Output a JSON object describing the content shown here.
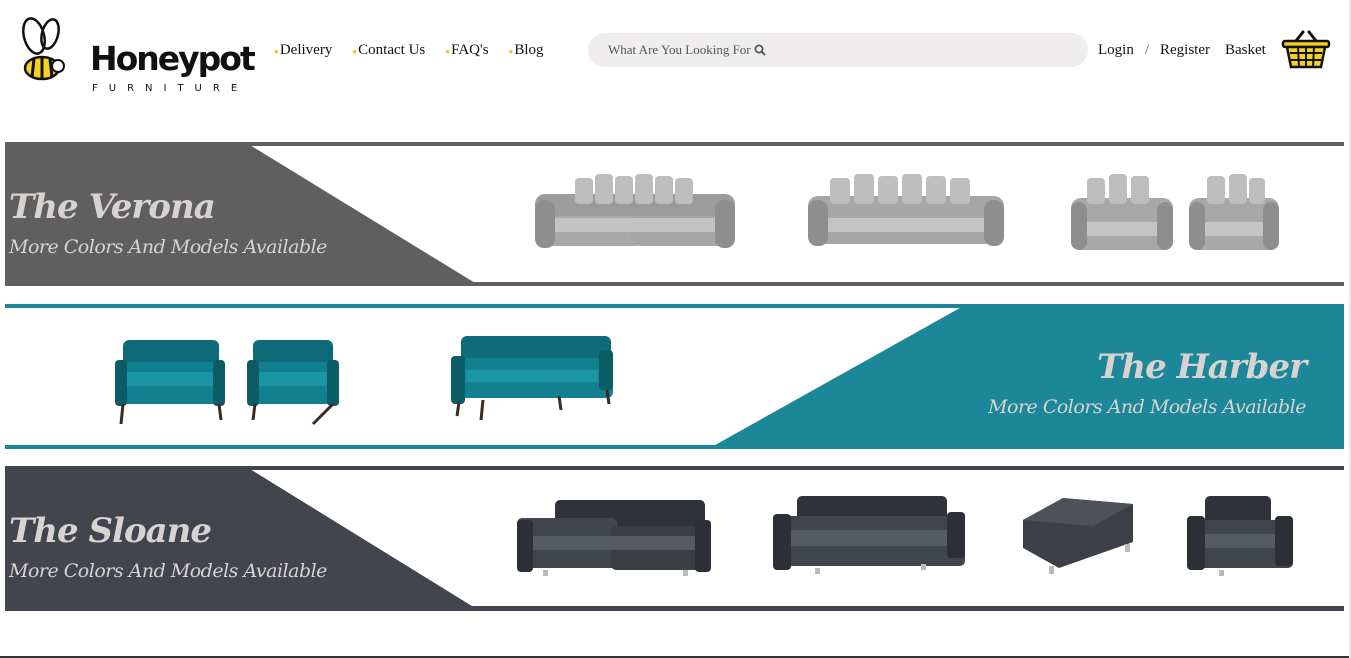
{
  "brand": {
    "name": "Honeypot",
    "tagline": "FURNITURE"
  },
  "nav": [
    {
      "label": "Delivery"
    },
    {
      "label": "Contact Us"
    },
    {
      "label": "FAQ's"
    },
    {
      "label": "Blog"
    }
  ],
  "search": {
    "placeholder": "What Are You Looking For"
  },
  "account": {
    "login": "Login",
    "separator": "/",
    "register": "Register",
    "basket": "Basket"
  },
  "banners": [
    {
      "title": "The Verona",
      "subtitle": "More Colors And Models Available",
      "color": "#5f5f5f",
      "products": [
        "corner sofa",
        "corner sofa",
        "sofa and armchair set"
      ]
    },
    {
      "title": "The Harber",
      "subtitle": "More Colors And Models Available",
      "color": "#1b8799",
      "products": [
        "sofa and armchair set",
        "four seater sofa"
      ]
    },
    {
      "title": "The Sloane",
      "subtitle": "More Colors And Models Available",
      "color": "#42454d",
      "products": [
        "corner sofa",
        "four seater sofa",
        "footstool",
        "armchair"
      ]
    }
  ],
  "colors": {
    "accent": "#f2c419",
    "search_bg": "#efeded"
  }
}
